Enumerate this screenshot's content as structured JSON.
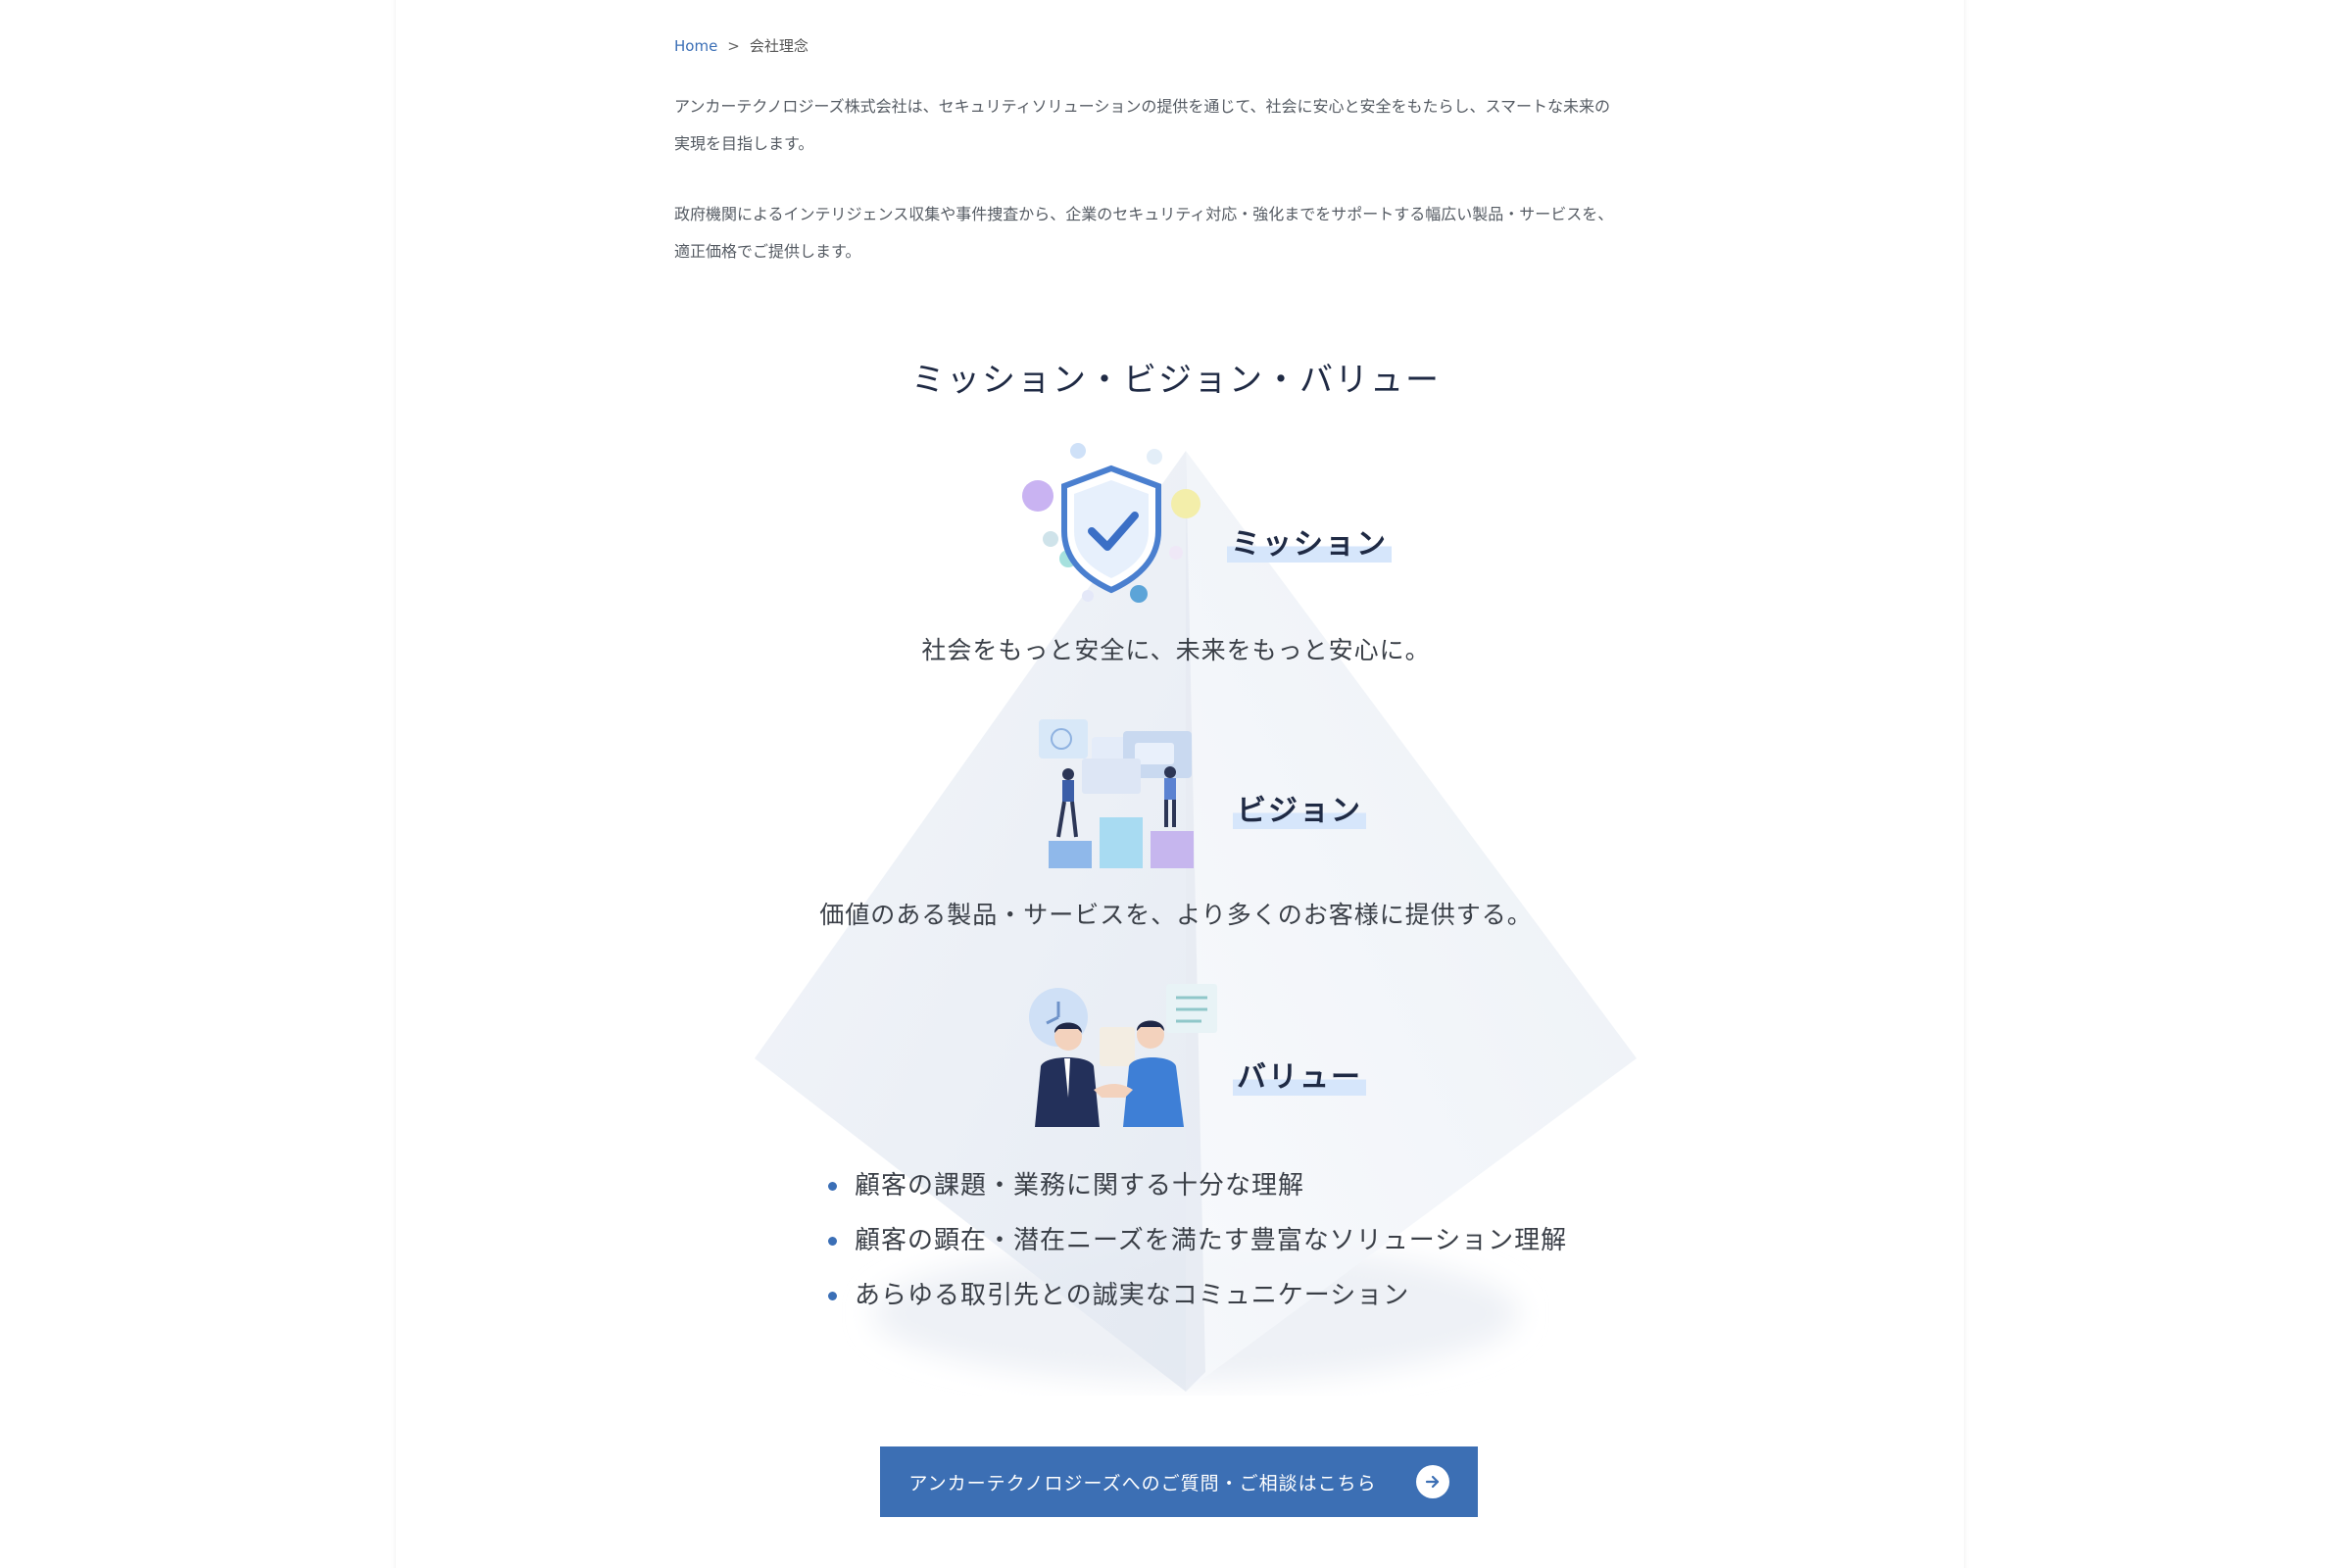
{
  "breadcrumb": {
    "home": "Home",
    "separator": ">",
    "current": "会社理念"
  },
  "intro": {
    "p1_line1": "アンカーテクノロジーズ株式会社は、セキュリティソリューションの提供を通じて、社会に安心と安全をもたらし、スマートな未来の",
    "p1_line2": "実現を目指します。",
    "p2_line1": "政府機関によるインテリジェンス収集や事件捜査から、企業のセキュリティ対応・強化までをサポートする幅広い製品・サービスを、",
    "p2_line2": "適正価格でご提供します。"
  },
  "section": {
    "title": "ミッション・ビジョン・バリュー"
  },
  "mission": {
    "label": "ミッション",
    "tagline": "社会をもっと安全に、未来をもっと安心に。"
  },
  "vision": {
    "label": "ビジョン",
    "tagline": "価値のある製品・サービスを、より多くのお客様に提供する。"
  },
  "value": {
    "label": "バリュー",
    "items": [
      "顧客の課題・業務に関する十分な理解",
      "顧客の顕在・潜在ニーズを満たす豊富なソリューション理解",
      "あらゆる取引先との誠実なコミュニケーション"
    ]
  },
  "cta": {
    "label": "アンカーテクノロジーズへのご質問・ご相談はこちら"
  },
  "icons": {
    "mission": "shield-check-icon",
    "vision": "team-dashboard-icon",
    "value": "handshake-icon",
    "cta": "arrow-right-icon"
  },
  "colors": {
    "accent": "#3c6fb4",
    "heading": "#1f2a44",
    "highlight": "#d6e6fb"
  }
}
